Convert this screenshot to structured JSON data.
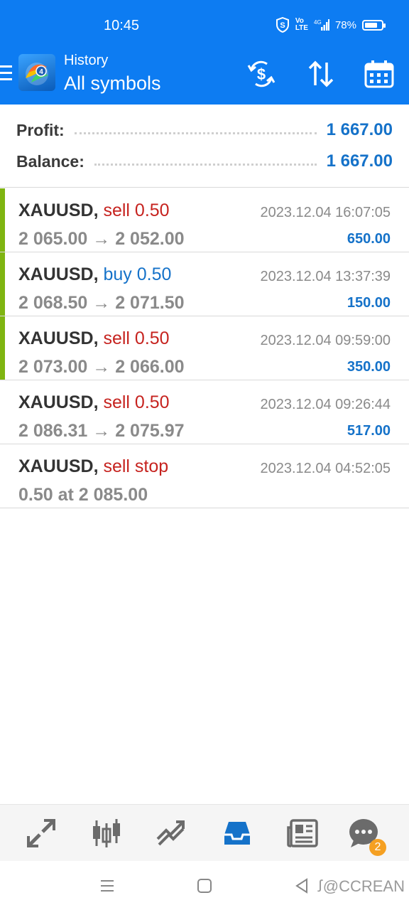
{
  "status_bar": {
    "time": "10:45",
    "network_label": "4G",
    "battery_text": "78%",
    "battery_level": 0.78
  },
  "app_bar": {
    "title": "History",
    "subtitle": "All symbols",
    "icons": [
      "currency-exchange-icon",
      "sort-icon",
      "calendar-icon"
    ]
  },
  "summary": {
    "profit_label": "Profit:",
    "profit_value": "1 667.00",
    "balance_label": "Balance:",
    "balance_value": "1 667.00"
  },
  "deals": [
    {
      "symbol": "XAUUSD,",
      "type": "sell 0.50",
      "prices": "2 065.00 → 2 052.00",
      "time": "2023.12.04 16:07:05",
      "profit": "650.00",
      "marker": true
    },
    {
      "symbol": "XAUUSD,",
      "type": "buy 0.50",
      "prices": "2 068.50 → 2 071.50",
      "time": "2023.12.04 13:37:39",
      "profit": "150.00",
      "marker": true
    },
    {
      "symbol": "XAUUSD,",
      "type": "sell 0.50",
      "prices": "2 073.00 → 2 066.00",
      "time": "2023.12.04 09:59:00",
      "profit": "350.00",
      "marker": true
    },
    {
      "symbol": "XAUUSD,",
      "type": "sell 0.50",
      "prices": "2 086.31 → 2 075.97",
      "time": "2023.12.04 09:26:44",
      "profit": "517.00",
      "marker": false
    },
    {
      "symbol": "XAUUSD,",
      "type": "sell stop",
      "prices": "0.50 at 2 085.00",
      "time": "2023.12.04 04:52:05",
      "profit": "",
      "marker": false
    }
  ],
  "bottom_nav": {
    "items": [
      "quotes-icon",
      "chart-icon",
      "trade-icon",
      "history-icon",
      "news-icon",
      "chat-icon"
    ],
    "active": "history-icon",
    "chat_badge": "2"
  },
  "system_nav": {
    "watermark": "@CCREAN"
  },
  "colors": {
    "primary": "#0d7cf2",
    "sell": "#c6231f",
    "buy": "#1572c9",
    "profit": "#1572c9",
    "marker": "#7fb511"
  }
}
